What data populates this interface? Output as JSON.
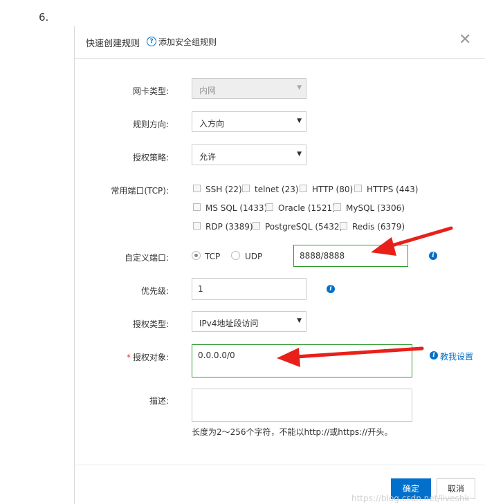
{
  "step_number": "6.",
  "dialog": {
    "title": "快速创建规则",
    "help_icon_glyph": "?",
    "add_rule_link": "添加安全组规则",
    "close_glyph": "✕"
  },
  "form": {
    "nic_type": {
      "label": "网卡类型:",
      "value": "内网"
    },
    "direction": {
      "label": "规则方向:",
      "value": "入方向"
    },
    "policy": {
      "label": "授权策略:",
      "value": "允许"
    },
    "common_ports": {
      "label": "常用端口(TCP):",
      "options": [
        [
          "SSH (22)",
          "telnet (23)",
          "HTTP (80)",
          "HTTPS (443)"
        ],
        [
          "MS SQL (1433)",
          "Oracle (1521)",
          "MySQL (3306)"
        ],
        [
          "RDP (3389)",
          "PostgreSQL (5432)",
          "Redis (6379)"
        ]
      ]
    },
    "custom_port": {
      "label": "自定义端口:",
      "tcp": "TCP",
      "udp": "UDP",
      "selected": "TCP",
      "value": "8888/8888"
    },
    "priority": {
      "label": "优先级:",
      "value": "1"
    },
    "auth_type": {
      "label": "授权类型:",
      "value": "IPv4地址段访问"
    },
    "auth_object": {
      "label": "授权对象:",
      "required_mark": "*",
      "value": "0.0.0.0/0",
      "teach_link": "教我设置"
    },
    "description": {
      "label": "描述:",
      "value": "",
      "hint": "长度为2～256个字符，不能以http://或https://开头。"
    }
  },
  "footer": {
    "confirm": "确定",
    "cancel": "取消"
  },
  "watermark": "https://blog.csdn.net/liveshk",
  "colors": {
    "primary": "#0070cc",
    "highlight_border": "#2a9a2a",
    "annotation_arrow": "#e8201a",
    "required": "#e4393c"
  },
  "icons": {
    "info": "info-circle-icon",
    "help": "question-circle-icon",
    "close": "close-icon",
    "dropdown": "caret-down-icon"
  }
}
